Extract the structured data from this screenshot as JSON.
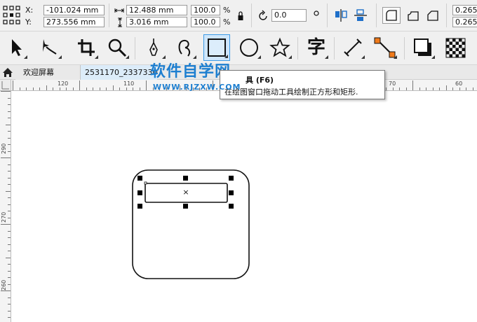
{
  "propbar": {
    "x_label": "X:",
    "y_label": "Y:",
    "x_value": "-101.024 mm",
    "y_value": "273.556 mm",
    "width_value": "12.488 mm",
    "height_value": "3.016 mm",
    "scale_w": "100.0",
    "scale_h": "100.0",
    "percent": "%",
    "rotation": "0.0",
    "outline_1": "0.265",
    "outline_2": "0.265"
  },
  "toolbox": {
    "tools": [
      {
        "name": "pick-tool",
        "icon": "arrow-icon"
      },
      {
        "name": "shape-tool",
        "icon": "shape-node-icon"
      },
      {
        "name": "crop-tool",
        "icon": "crop-icon"
      },
      {
        "name": "zoom-tool",
        "icon": "magnifier-icon"
      },
      {
        "name": "pen-tool",
        "icon": "pen-nib-icon"
      },
      {
        "name": "freehand-tool",
        "icon": "curve-hook-icon"
      },
      {
        "name": "rectangle-tool",
        "icon": "rectangle-icon",
        "active": true
      },
      {
        "name": "ellipse-tool",
        "icon": "ellipse-icon"
      },
      {
        "name": "polygon-tool",
        "icon": "star-icon"
      },
      {
        "name": "text-tool",
        "icon": "text-zi-icon"
      },
      {
        "name": "dimension-tool",
        "icon": "dimension-line-icon"
      },
      {
        "name": "connector-tool",
        "icon": "connector-icon"
      },
      {
        "name": "drop-shadow-tool",
        "icon": "shadow-square-icon"
      },
      {
        "name": "transparency-tool",
        "icon": "checker-icon"
      }
    ],
    "text_glyph": "字"
  },
  "tabs": {
    "home_icon": "home-icon",
    "welcome": "欢迎屏幕",
    "document": "2531170_23373302"
  },
  "rulers": {
    "h_labels": [
      "120",
      "110",
      "70",
      "60"
    ],
    "v_labels": [
      "290",
      "270",
      "260"
    ]
  },
  "tooltip": {
    "title": "具 (F6)",
    "description": "在绘图窗口拖动工具绘制正方形和矩形."
  },
  "watermark": {
    "text": "软件自学网",
    "url": "WWW.RJZXW.COM"
  },
  "selection": {
    "center_mark": "×"
  },
  "colors": {
    "accent": "#1e7fd0",
    "active_tool_bg": "#cfe6fb",
    "handle": "#000000",
    "connector_orange": "#f07a1a"
  }
}
